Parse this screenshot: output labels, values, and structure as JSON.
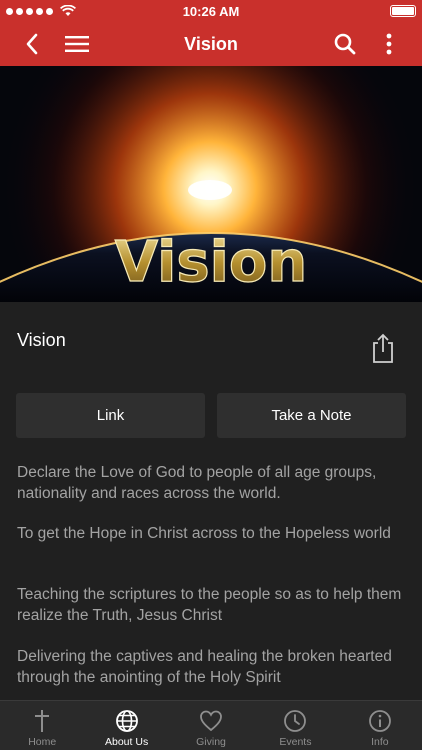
{
  "status_bar": {
    "time": "10:26 AM"
  },
  "nav": {
    "title": "Vision"
  },
  "hero": {
    "image_text": "Vision"
  },
  "item": {
    "title": "Vision"
  },
  "buttons": {
    "link": "Link",
    "note": "Take a Note"
  },
  "paragraphs": [
    "Declare the Love of God to people of all age groups, nationality and races across the world.",
    "To get the Hope in Christ across to the Hopeless world",
    "Teaching the scriptures to the people so as to help them realize the Truth, Jesus Christ",
    "Delivering the captives and healing the broken hearted through the anointing of the Holy Spirit"
  ],
  "tabs": [
    {
      "label": "Home",
      "icon": "cross-icon",
      "active": false
    },
    {
      "label": "About Us",
      "icon": "globe-icon",
      "active": true
    },
    {
      "label": "Giving",
      "icon": "heart-icon",
      "active": false
    },
    {
      "label": "Events",
      "icon": "clock-icon",
      "active": false
    },
    {
      "label": "Info",
      "icon": "info-icon",
      "active": false
    }
  ],
  "colors": {
    "header": "#c9302c",
    "background": "#202020",
    "button": "#2f2f2f",
    "body_text": "#a3a3a3"
  }
}
